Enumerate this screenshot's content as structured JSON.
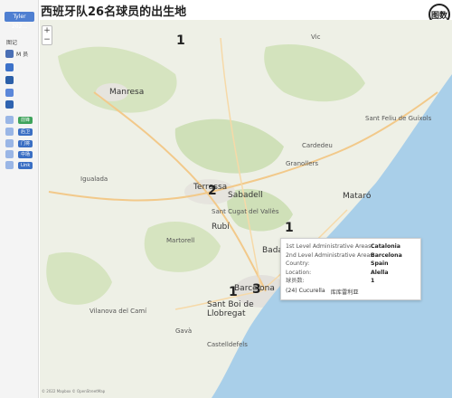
{
  "title": "西班牙队26名球员的出生地",
  "logo_text": "图数",
  "sidebar": {
    "tab_label": "Tyler 202...",
    "legend_title": "图记",
    "legend_items": [
      {
        "label": "M 员",
        "color": "#4a6fb5"
      },
      {
        "label": "",
        "color": "#3d72c9"
      },
      {
        "label": "",
        "color": "#2b5fa8"
      },
      {
        "label": "",
        "color": "#5b87d9"
      },
      {
        "label": "",
        "color": "#2f63b0"
      }
    ],
    "chips": [
      {
        "label": "前锋",
        "color": "#3fa35c"
      },
      {
        "label": "后卫",
        "color": "#3b6fc4"
      },
      {
        "label": "门将",
        "color": "#3b6fc4"
      },
      {
        "label": "中场",
        "color": "#3b6fc4"
      },
      {
        "label": "Link",
        "color": "#3b6fc4"
      }
    ]
  },
  "map": {
    "zoom_in": "+",
    "zoom_out": "−",
    "places": [
      {
        "name": "Manresa",
        "big": true
      },
      {
        "name": "Terrassa",
        "big": true
      },
      {
        "name": "Sabadell",
        "big": true
      },
      {
        "name": "Rubí",
        "big": true
      },
      {
        "name": "Mataró",
        "big": true
      },
      {
        "name": "Badalona",
        "big": true
      },
      {
        "name": "Barcelona",
        "big": true
      },
      {
        "name": "Sant Boi de Llobregat",
        "big": true
      },
      {
        "name": "Vic",
        "big": false
      },
      {
        "name": "Granollers",
        "big": false
      },
      {
        "name": "Igualada",
        "big": false
      },
      {
        "name": "Martorell",
        "big": false
      },
      {
        "name": "Castelldefels",
        "big": false
      },
      {
        "name": "Cardedeu",
        "big": false
      },
      {
        "name": "Vilanova del Camí",
        "big": false
      },
      {
        "name": "Gavà",
        "big": false
      },
      {
        "name": "Sant Cugat del Vallès",
        "big": false
      },
      {
        "name": "Sant Feliu de Guíxols",
        "big": false
      }
    ],
    "counts": [
      {
        "value": "1"
      },
      {
        "value": "2"
      },
      {
        "value": "1"
      },
      {
        "value": "1"
      },
      {
        "value": "3"
      }
    ],
    "copyright": "© 2022 Mapbox © OpenStreetMap"
  },
  "tooltip": {
    "rows": [
      {
        "key": "1st Level Administrative Areas:",
        "value": "Catalonia"
      },
      {
        "key": "2nd Level Administrative Areas:",
        "value": "Barcelona"
      },
      {
        "key": "Country:",
        "value": "Spain"
      },
      {
        "key": "Location:",
        "value": "Alella"
      },
      {
        "key": "球员数:",
        "value": "1"
      }
    ],
    "player_number": "(24) Cucurella",
    "player_name": "库库雷利亚"
  },
  "colors": {
    "sea": "#a9cfe9",
    "land": "#eef0e6",
    "forest": "#cfe0b8",
    "road": "#f2c98a",
    "urban": "#e3e1dc"
  }
}
